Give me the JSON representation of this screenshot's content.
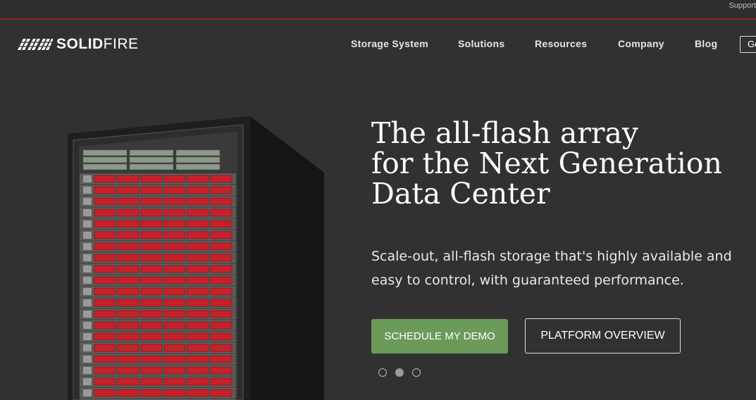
{
  "topbar": {
    "support_label": "Support"
  },
  "brand": {
    "bold": "SOLID",
    "thin": "FIRE"
  },
  "nav": {
    "items": [
      {
        "label": "Storage System"
      },
      {
        "label": "Solutions"
      },
      {
        "label": "Resources"
      },
      {
        "label": "Company"
      },
      {
        "label": "Blog"
      }
    ],
    "cta_label": "Ge"
  },
  "hero": {
    "headline_lines": [
      "The all-flash array",
      "for the Next Generation",
      "Data Center"
    ],
    "subtext": "Scale-out, all-flash storage that's highly available and easy to control, with guaranteed performance.",
    "primary_button": "SCHEDULE MY DEMO",
    "secondary_button": "PLATFORM OVERVIEW",
    "carousel": {
      "total": 3,
      "active": 2
    }
  },
  "colors": {
    "accent_green": "#6b9a59",
    "brand_red": "#8a1f1f",
    "drive_red": "#c8202a",
    "background": "#313131"
  }
}
